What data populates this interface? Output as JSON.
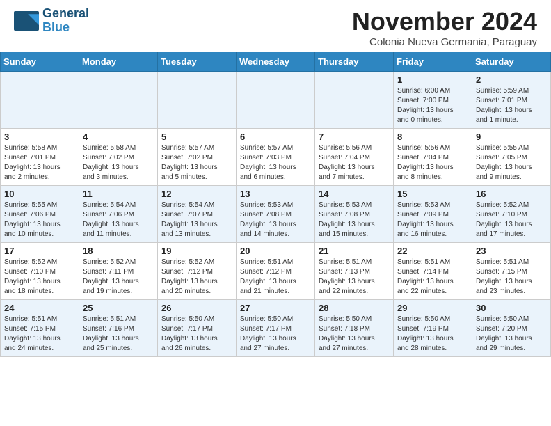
{
  "header": {
    "logo_line1": "General",
    "logo_line2": "Blue",
    "title": "November 2024",
    "location": "Colonia Nueva Germania, Paraguay"
  },
  "weekdays": [
    "Sunday",
    "Monday",
    "Tuesday",
    "Wednesday",
    "Thursday",
    "Friday",
    "Saturday"
  ],
  "weeks": [
    [
      {
        "day": "",
        "info": ""
      },
      {
        "day": "",
        "info": ""
      },
      {
        "day": "",
        "info": ""
      },
      {
        "day": "",
        "info": ""
      },
      {
        "day": "",
        "info": ""
      },
      {
        "day": "1",
        "info": "Sunrise: 6:00 AM\nSunset: 7:00 PM\nDaylight: 13 hours\nand 0 minutes."
      },
      {
        "day": "2",
        "info": "Sunrise: 5:59 AM\nSunset: 7:01 PM\nDaylight: 13 hours\nand 1 minute."
      }
    ],
    [
      {
        "day": "3",
        "info": "Sunrise: 5:58 AM\nSunset: 7:01 PM\nDaylight: 13 hours\nand 2 minutes."
      },
      {
        "day": "4",
        "info": "Sunrise: 5:58 AM\nSunset: 7:02 PM\nDaylight: 13 hours\nand 3 minutes."
      },
      {
        "day": "5",
        "info": "Sunrise: 5:57 AM\nSunset: 7:02 PM\nDaylight: 13 hours\nand 5 minutes."
      },
      {
        "day": "6",
        "info": "Sunrise: 5:57 AM\nSunset: 7:03 PM\nDaylight: 13 hours\nand 6 minutes."
      },
      {
        "day": "7",
        "info": "Sunrise: 5:56 AM\nSunset: 7:04 PM\nDaylight: 13 hours\nand 7 minutes."
      },
      {
        "day": "8",
        "info": "Sunrise: 5:56 AM\nSunset: 7:04 PM\nDaylight: 13 hours\nand 8 minutes."
      },
      {
        "day": "9",
        "info": "Sunrise: 5:55 AM\nSunset: 7:05 PM\nDaylight: 13 hours\nand 9 minutes."
      }
    ],
    [
      {
        "day": "10",
        "info": "Sunrise: 5:55 AM\nSunset: 7:06 PM\nDaylight: 13 hours\nand 10 minutes."
      },
      {
        "day": "11",
        "info": "Sunrise: 5:54 AM\nSunset: 7:06 PM\nDaylight: 13 hours\nand 11 minutes."
      },
      {
        "day": "12",
        "info": "Sunrise: 5:54 AM\nSunset: 7:07 PM\nDaylight: 13 hours\nand 13 minutes."
      },
      {
        "day": "13",
        "info": "Sunrise: 5:53 AM\nSunset: 7:08 PM\nDaylight: 13 hours\nand 14 minutes."
      },
      {
        "day": "14",
        "info": "Sunrise: 5:53 AM\nSunset: 7:08 PM\nDaylight: 13 hours\nand 15 minutes."
      },
      {
        "day": "15",
        "info": "Sunrise: 5:53 AM\nSunset: 7:09 PM\nDaylight: 13 hours\nand 16 minutes."
      },
      {
        "day": "16",
        "info": "Sunrise: 5:52 AM\nSunset: 7:10 PM\nDaylight: 13 hours\nand 17 minutes."
      }
    ],
    [
      {
        "day": "17",
        "info": "Sunrise: 5:52 AM\nSunset: 7:10 PM\nDaylight: 13 hours\nand 18 minutes."
      },
      {
        "day": "18",
        "info": "Sunrise: 5:52 AM\nSunset: 7:11 PM\nDaylight: 13 hours\nand 19 minutes."
      },
      {
        "day": "19",
        "info": "Sunrise: 5:52 AM\nSunset: 7:12 PM\nDaylight: 13 hours\nand 20 minutes."
      },
      {
        "day": "20",
        "info": "Sunrise: 5:51 AM\nSunset: 7:12 PM\nDaylight: 13 hours\nand 21 minutes."
      },
      {
        "day": "21",
        "info": "Sunrise: 5:51 AM\nSunset: 7:13 PM\nDaylight: 13 hours\nand 22 minutes."
      },
      {
        "day": "22",
        "info": "Sunrise: 5:51 AM\nSunset: 7:14 PM\nDaylight: 13 hours\nand 22 minutes."
      },
      {
        "day": "23",
        "info": "Sunrise: 5:51 AM\nSunset: 7:15 PM\nDaylight: 13 hours\nand 23 minutes."
      }
    ],
    [
      {
        "day": "24",
        "info": "Sunrise: 5:51 AM\nSunset: 7:15 PM\nDaylight: 13 hours\nand 24 minutes."
      },
      {
        "day": "25",
        "info": "Sunrise: 5:51 AM\nSunset: 7:16 PM\nDaylight: 13 hours\nand 25 minutes."
      },
      {
        "day": "26",
        "info": "Sunrise: 5:50 AM\nSunset: 7:17 PM\nDaylight: 13 hours\nand 26 minutes."
      },
      {
        "day": "27",
        "info": "Sunrise: 5:50 AM\nSunset: 7:17 PM\nDaylight: 13 hours\nand 27 minutes."
      },
      {
        "day": "28",
        "info": "Sunrise: 5:50 AM\nSunset: 7:18 PM\nDaylight: 13 hours\nand 27 minutes."
      },
      {
        "day": "29",
        "info": "Sunrise: 5:50 AM\nSunset: 7:19 PM\nDaylight: 13 hours\nand 28 minutes."
      },
      {
        "day": "30",
        "info": "Sunrise: 5:50 AM\nSunset: 7:20 PM\nDaylight: 13 hours\nand 29 minutes."
      }
    ]
  ],
  "colors": {
    "header_bg": "#2e86c1",
    "row_odd": "#eaf3fb",
    "row_even": "#ffffff"
  }
}
